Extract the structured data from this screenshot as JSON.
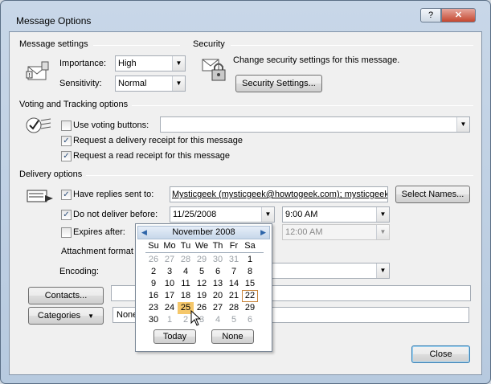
{
  "window": {
    "title": "Message Options",
    "help_label": "?",
    "close_label": "✕"
  },
  "message_settings": {
    "heading": "Message settings",
    "importance_label": "Importance:",
    "importance_value": "High",
    "sensitivity_label": "Sensitivity:",
    "sensitivity_value": "Normal"
  },
  "security": {
    "heading": "Security",
    "description": "Change security settings for this message.",
    "button_label": "Security Settings..."
  },
  "voting": {
    "heading": "Voting and Tracking options",
    "use_voting_label": "Use voting buttons:",
    "use_voting_checked": false,
    "use_voting_value": "",
    "delivery_receipt_label": "Request a delivery receipt for this message",
    "delivery_receipt_checked": true,
    "read_receipt_label": "Request a read receipt for this message",
    "read_receipt_checked": true
  },
  "delivery": {
    "heading": "Delivery options",
    "replies_label": "Have replies sent to:",
    "replies_checked": true,
    "replies_value": "Mysticgeek (mysticgeek@howtogeek.com); mysticgeek",
    "select_names_label": "Select Names...",
    "do_not_deliver_label": "Do not deliver before:",
    "do_not_deliver_checked": true,
    "do_not_deliver_date": "11/25/2008",
    "do_not_deliver_time": "9:00 AM",
    "expires_label": "Expires after:",
    "expires_checked": false,
    "expires_time": "12:00 AM",
    "attachment_format_label": "Attachment format",
    "encoding_label": "Encoding:"
  },
  "contacts_button_label": "Contacts...",
  "categories_button_label": "Categories",
  "categories_value": "None",
  "close_button_label": "Close",
  "calendar": {
    "month_label": "November 2008",
    "weekdays": [
      "Su",
      "Mo",
      "Tu",
      "We",
      "Th",
      "Fr",
      "Sa"
    ],
    "weeks": [
      [
        "26",
        "27",
        "28",
        "29",
        "30",
        "31",
        "1"
      ],
      [
        "2",
        "3",
        "4",
        "5",
        "6",
        "7",
        "8"
      ],
      [
        "9",
        "10",
        "11",
        "12",
        "13",
        "14",
        "15"
      ],
      [
        "16",
        "17",
        "18",
        "19",
        "20",
        "21",
        "22"
      ],
      [
        "23",
        "24",
        "25",
        "26",
        "27",
        "28",
        "29"
      ],
      [
        "30",
        "1",
        "2",
        "3",
        "4",
        "5",
        "6"
      ]
    ],
    "selected_day": "25",
    "today_day": "22",
    "today_label": "Today",
    "none_label": "None"
  },
  "colors": {
    "selected_day": "#f5c76a",
    "today_outline": "#c8843a",
    "accent": "#2c64a8"
  }
}
